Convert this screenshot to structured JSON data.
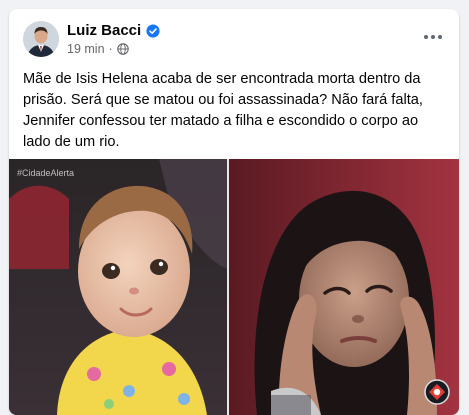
{
  "post": {
    "author": "Luiz Bacci",
    "time": "19 min",
    "separator": "·",
    "verified_icon": "verified-badge-icon",
    "privacy_icon": "globe-icon",
    "options_icon": "more-options-icon",
    "text": "Mãe de Isis Helena acaba de ser encontrada morta dentro da prisão. Será que se matou ou foi assassinada? Não fará falta, Jennifer confessou ter matado a filha e escondido o corpo ao lado de um rio."
  },
  "media": {
    "watermark": "#CidadeAlerta",
    "left_photo": "toddler-photo",
    "right_photo": "woman-photo",
    "logo": "record-tv-logo"
  },
  "colors": {
    "page_bg": "#f0f2f5",
    "card_bg": "#ffffff",
    "text": "#050505",
    "secondary_text": "#65676b",
    "verified": "#1877f2"
  }
}
